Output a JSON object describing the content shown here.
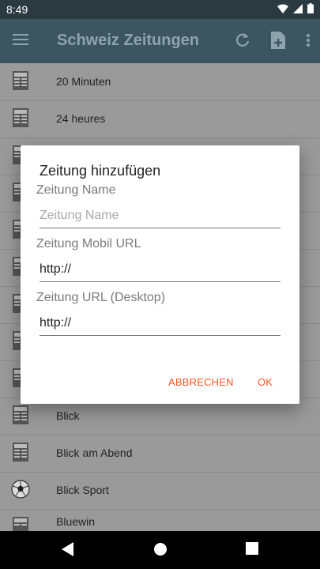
{
  "status_bar": {
    "time": "8:49"
  },
  "app_bar": {
    "title": "Schweiz Zeitungen"
  },
  "list": {
    "items": [
      {
        "label": "20 Minuten",
        "icon": "newspaper-icon"
      },
      {
        "label": "24 heures",
        "icon": "newspaper-icon"
      },
      {
        "label": "",
        "icon": "newspaper-icon"
      },
      {
        "label": "",
        "icon": "newspaper-icon"
      },
      {
        "label": "",
        "icon": "newspaper-icon"
      },
      {
        "label": "",
        "icon": "newspaper-icon"
      },
      {
        "label": "",
        "icon": "newspaper-icon"
      },
      {
        "label": "",
        "icon": "newspaper-icon"
      },
      {
        "label": "",
        "icon": "newspaper-icon"
      },
      {
        "label": "Blick",
        "icon": "newspaper-icon"
      },
      {
        "label": "Blick am Abend",
        "icon": "newspaper-icon"
      },
      {
        "label": "Blick Sport",
        "icon": "soccer-ball-icon"
      },
      {
        "label": "Bluewin",
        "icon": "newspaper-icon"
      }
    ]
  },
  "dialog": {
    "title": "Zeitung hinzufügen",
    "name_label": "Zeitung Name",
    "name_placeholder": "Zeitung Name",
    "name_value": "",
    "mobile_label": "Zeitung Mobil URL",
    "mobile_value": "http://",
    "desktop_label": "Zeitung URL (Desktop)",
    "desktop_value": "http://",
    "cancel_label": "ABBRECHEN",
    "ok_label": "OK"
  },
  "colors": {
    "accent": "#ff5722",
    "app_bar": "#3c5560",
    "status_bar": "#2b3a41"
  }
}
